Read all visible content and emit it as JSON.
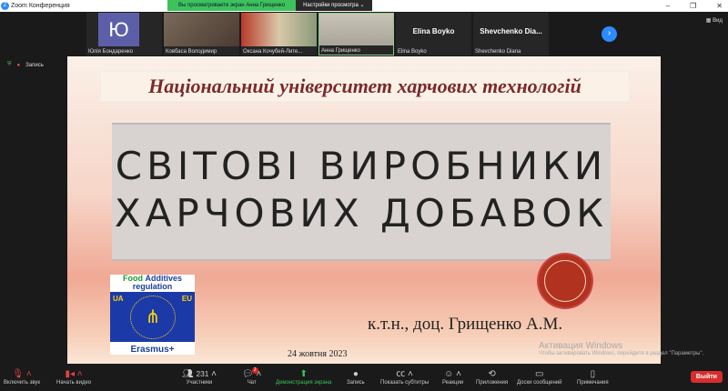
{
  "window": {
    "title": "Zoom Конференция",
    "minimize": "–",
    "maximize": "❐",
    "close": "✕"
  },
  "share_banner": {
    "status": "Вы просматриваете экран Анна Грищенко",
    "options": "Настройки просмотра ⌄"
  },
  "participants_strip": [
    {
      "name": "Юлія Бондаренко",
      "avatar_letter": "Ю",
      "type": "avatar"
    },
    {
      "name": "Ковбаса Володимир",
      "type": "video",
      "color": "#6b5a4e"
    },
    {
      "name": "Оксана Кочубей-Лите...",
      "type": "video",
      "color": "#8a4a3a"
    },
    {
      "name": "Анна Грищенко",
      "type": "video",
      "color": "#b8b4a8"
    },
    {
      "name": "Elina Boyko",
      "display": "Elina Boyko",
      "type": "name"
    },
    {
      "name": "Shevchenko Diana",
      "display": "Shevchenko  Dia...",
      "type": "name"
    }
  ],
  "view_button": "Вид",
  "recording": "Запись",
  "slide": {
    "university": "Національний університет харчових технологій",
    "title_line1": "СВІТОВІ ВИРОБНИКИ",
    "title_line2": "ХАРЧОВИХ ДОБАВОК",
    "logo": {
      "food": "Food",
      "additives": "Additives",
      "regulation": "regulation",
      "ua": "UA",
      "eu": "EU",
      "erasmus": "Erasmus+"
    },
    "author": "к.т.н., доц. Грищенко А.М.",
    "date": "24 жовтня 2023"
  },
  "watermark": {
    "title": "Активация Windows",
    "subtitle": "Чтобы активировать Windows, перейдите в раздел \"Параметры\"."
  },
  "toolbar": {
    "unmute": "Включить звук",
    "start_video": "Начать видео",
    "participants": "Участники",
    "participants_count": "231",
    "chat": "Чат",
    "chat_badge": "2",
    "share": "Демонстрация экрана",
    "record": "Запись",
    "captions": "Показать субтитры",
    "reactions": "Реакции",
    "apps": "Приложения",
    "whiteboards": "Доски сообщений",
    "notes": "Примечания",
    "leave": "Выйти"
  },
  "colors": {
    "accent": "#2d8cff",
    "share_green": "#3cc35c",
    "leave_red": "#d92d2d"
  }
}
